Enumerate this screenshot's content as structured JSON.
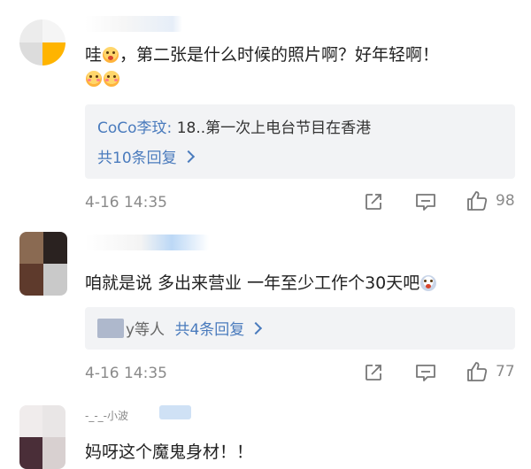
{
  "comments": [
    {
      "text_before": "哇",
      "text_after": "，第二张是什么时候的照片啊？好年轻啊！",
      "reply_author": "CoCo李玟",
      "reply_sep": ": ",
      "reply_text": "18..第一次上电台节目在香港",
      "reply_count": "共10条回复",
      "time": "4-16 14:35",
      "likes": "98"
    },
    {
      "text": "咱就是说 多出来营业 一年至少工作个30天吧",
      "reply_people_suffix": "y等人",
      "reply_count": "共4条回复",
      "time": "4-16 14:35",
      "likes": "77"
    },
    {
      "name_fragment": "-_-_-小波",
      "text": "妈呀这个魔鬼身材！！"
    }
  ],
  "icons": {
    "share": "share-icon",
    "comment": "comment-icon",
    "like": "thumbs-up-icon"
  },
  "colors": {
    "link": "#4a7bbd",
    "meta": "#8a8a8a",
    "reply_bg": "#f2f3f5"
  }
}
